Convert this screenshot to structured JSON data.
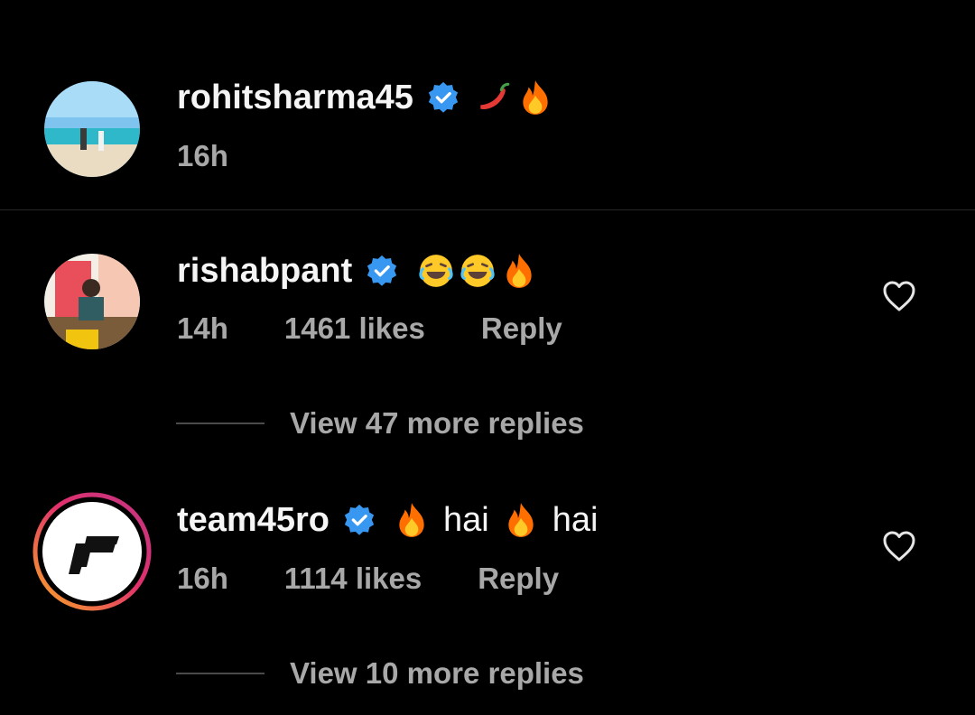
{
  "caption": {
    "username": "rohitsharma45",
    "emojis": [
      "chili",
      "fire"
    ],
    "time": "16h"
  },
  "comments": [
    {
      "username": "rishabpant",
      "emojis": [
        "laughing",
        "laughing",
        "fire"
      ],
      "time": "14h",
      "likes": "1461 likes",
      "reply_label": "Reply",
      "view_replies": "View 47 more replies"
    },
    {
      "username": "team45ro",
      "text_parts": [
        "hai",
        "hai"
      ],
      "time": "16h",
      "likes": "1114 likes",
      "reply_label": "Reply",
      "view_replies": "View 10 more replies"
    }
  ],
  "icons": {
    "verified": "verified-badge-icon",
    "like": "heart-outline-icon"
  },
  "colors": {
    "background": "#000000",
    "verified_blue": "#3897f0",
    "secondary_text": "#a8a8a8",
    "story_ring_start": "#f9a825",
    "story_ring_end": "#c13584"
  }
}
